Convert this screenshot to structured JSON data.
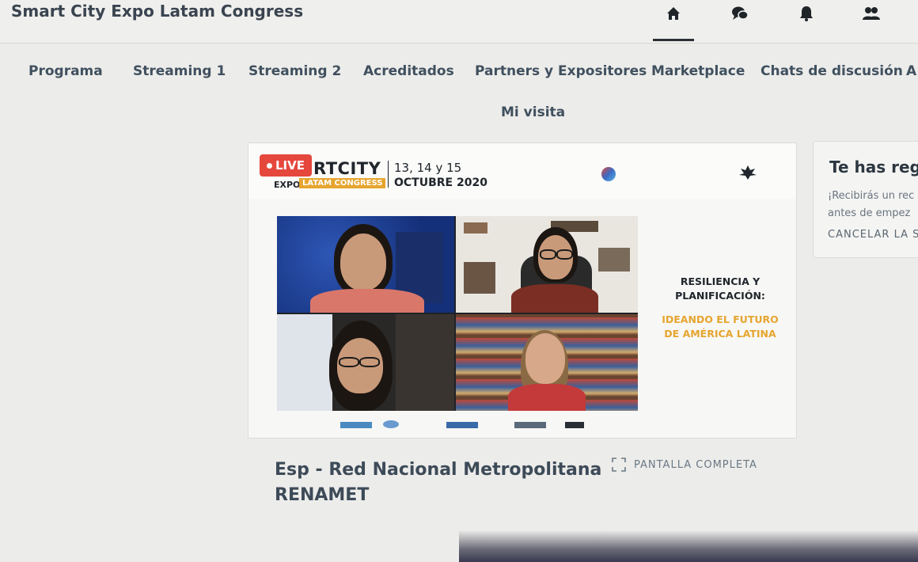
{
  "app": {
    "title": "Smart City Expo Latam Congress"
  },
  "top_icons": [
    "home-icon",
    "chat-icon",
    "bell-icon",
    "people-icon"
  ],
  "nav": {
    "items": [
      {
        "label": "Programa"
      },
      {
        "label": "Streaming 1"
      },
      {
        "label": "Streaming 2"
      },
      {
        "label": "Acreditados"
      },
      {
        "label": "Partners y Expositores"
      },
      {
        "label": "Marketplace"
      },
      {
        "label": "Chats de discusión"
      },
      {
        "label": "A"
      },
      {
        "label": "Mi visita"
      }
    ]
  },
  "player": {
    "live_label": "LIVE",
    "brand": {
      "main": "RTCITY",
      "expo": "EXPO",
      "latam": "LATAM CONGRESS",
      "dates": "13, 14 y 15",
      "month": "OCTUBRE 2020"
    },
    "topic_line1": "RESILIENCIA Y",
    "topic_line2": "PLANIFICACIÓN:",
    "topic_line3": "IDEANDO EL FUTURO",
    "topic_line4": "DE AMÉRICA LATINA"
  },
  "session": {
    "title_line1": "Esp - Red Nacional Metropolitana",
    "title_line2": "RENAMET",
    "fullscreen_label": "PANTALLA COMPLETA"
  },
  "side_card": {
    "title": "Te has reg",
    "body_line1": "¡Recibirás un rec",
    "body_line2": "antes de empez",
    "cancel_label": "CANCELAR LA S"
  },
  "colors": {
    "live": "#e5473d",
    "accent": "#e6a52f",
    "nav_text": "#40505f"
  }
}
